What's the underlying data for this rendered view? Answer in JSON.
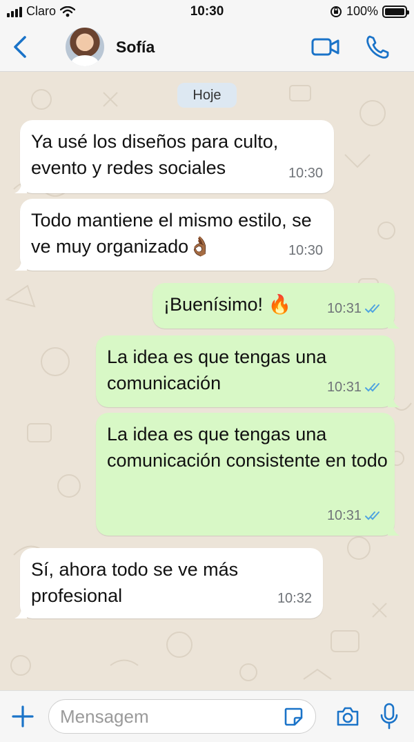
{
  "status_bar": {
    "carrier": "Claro",
    "time": "10:30",
    "battery": "100%",
    "battery_level": 1.0
  },
  "header": {
    "contact_name": "Sofía",
    "icons": [
      "back-chevron-icon",
      "avatar",
      "video-call-icon",
      "phone-icon"
    ]
  },
  "chat": {
    "date_label": "Hoje",
    "messages": [
      {
        "direction": "in",
        "text": "Ya usé los diseños para culto, evento y redes sociales",
        "time": "10:30"
      },
      {
        "direction": "in",
        "text": "Todo mantiene el mismo estilo, se ve muy organizado👌🏾",
        "time": "10:30"
      },
      {
        "direction": "out",
        "text": "¡Buenísimo! 🔥",
        "time": "10:31",
        "status": "read"
      },
      {
        "direction": "out",
        "text": "La idea es que tengas una comunicación",
        "time": "10:31",
        "status": "read"
      },
      {
        "direction": "out",
        "text": "La idea es que tengas una comunicación consistente en todo",
        "time": "10:31",
        "status": "read"
      },
      {
        "direction": "in",
        "text": "Sí, ahora todo se ve más profesional",
        "time": "10:32"
      }
    ]
  },
  "input_bar": {
    "placeholder": "Mensagem",
    "icons": [
      "plus-icon",
      "sticker-icon",
      "camera-icon",
      "microphone-icon"
    ]
  },
  "colors": {
    "accent": "#1a73c8",
    "outgoing_bubble": "#d8f8c6",
    "incoming_bubble": "#ffffff",
    "read_ticks": "#4fa3e0",
    "wallpaper": "#ece4d8"
  }
}
